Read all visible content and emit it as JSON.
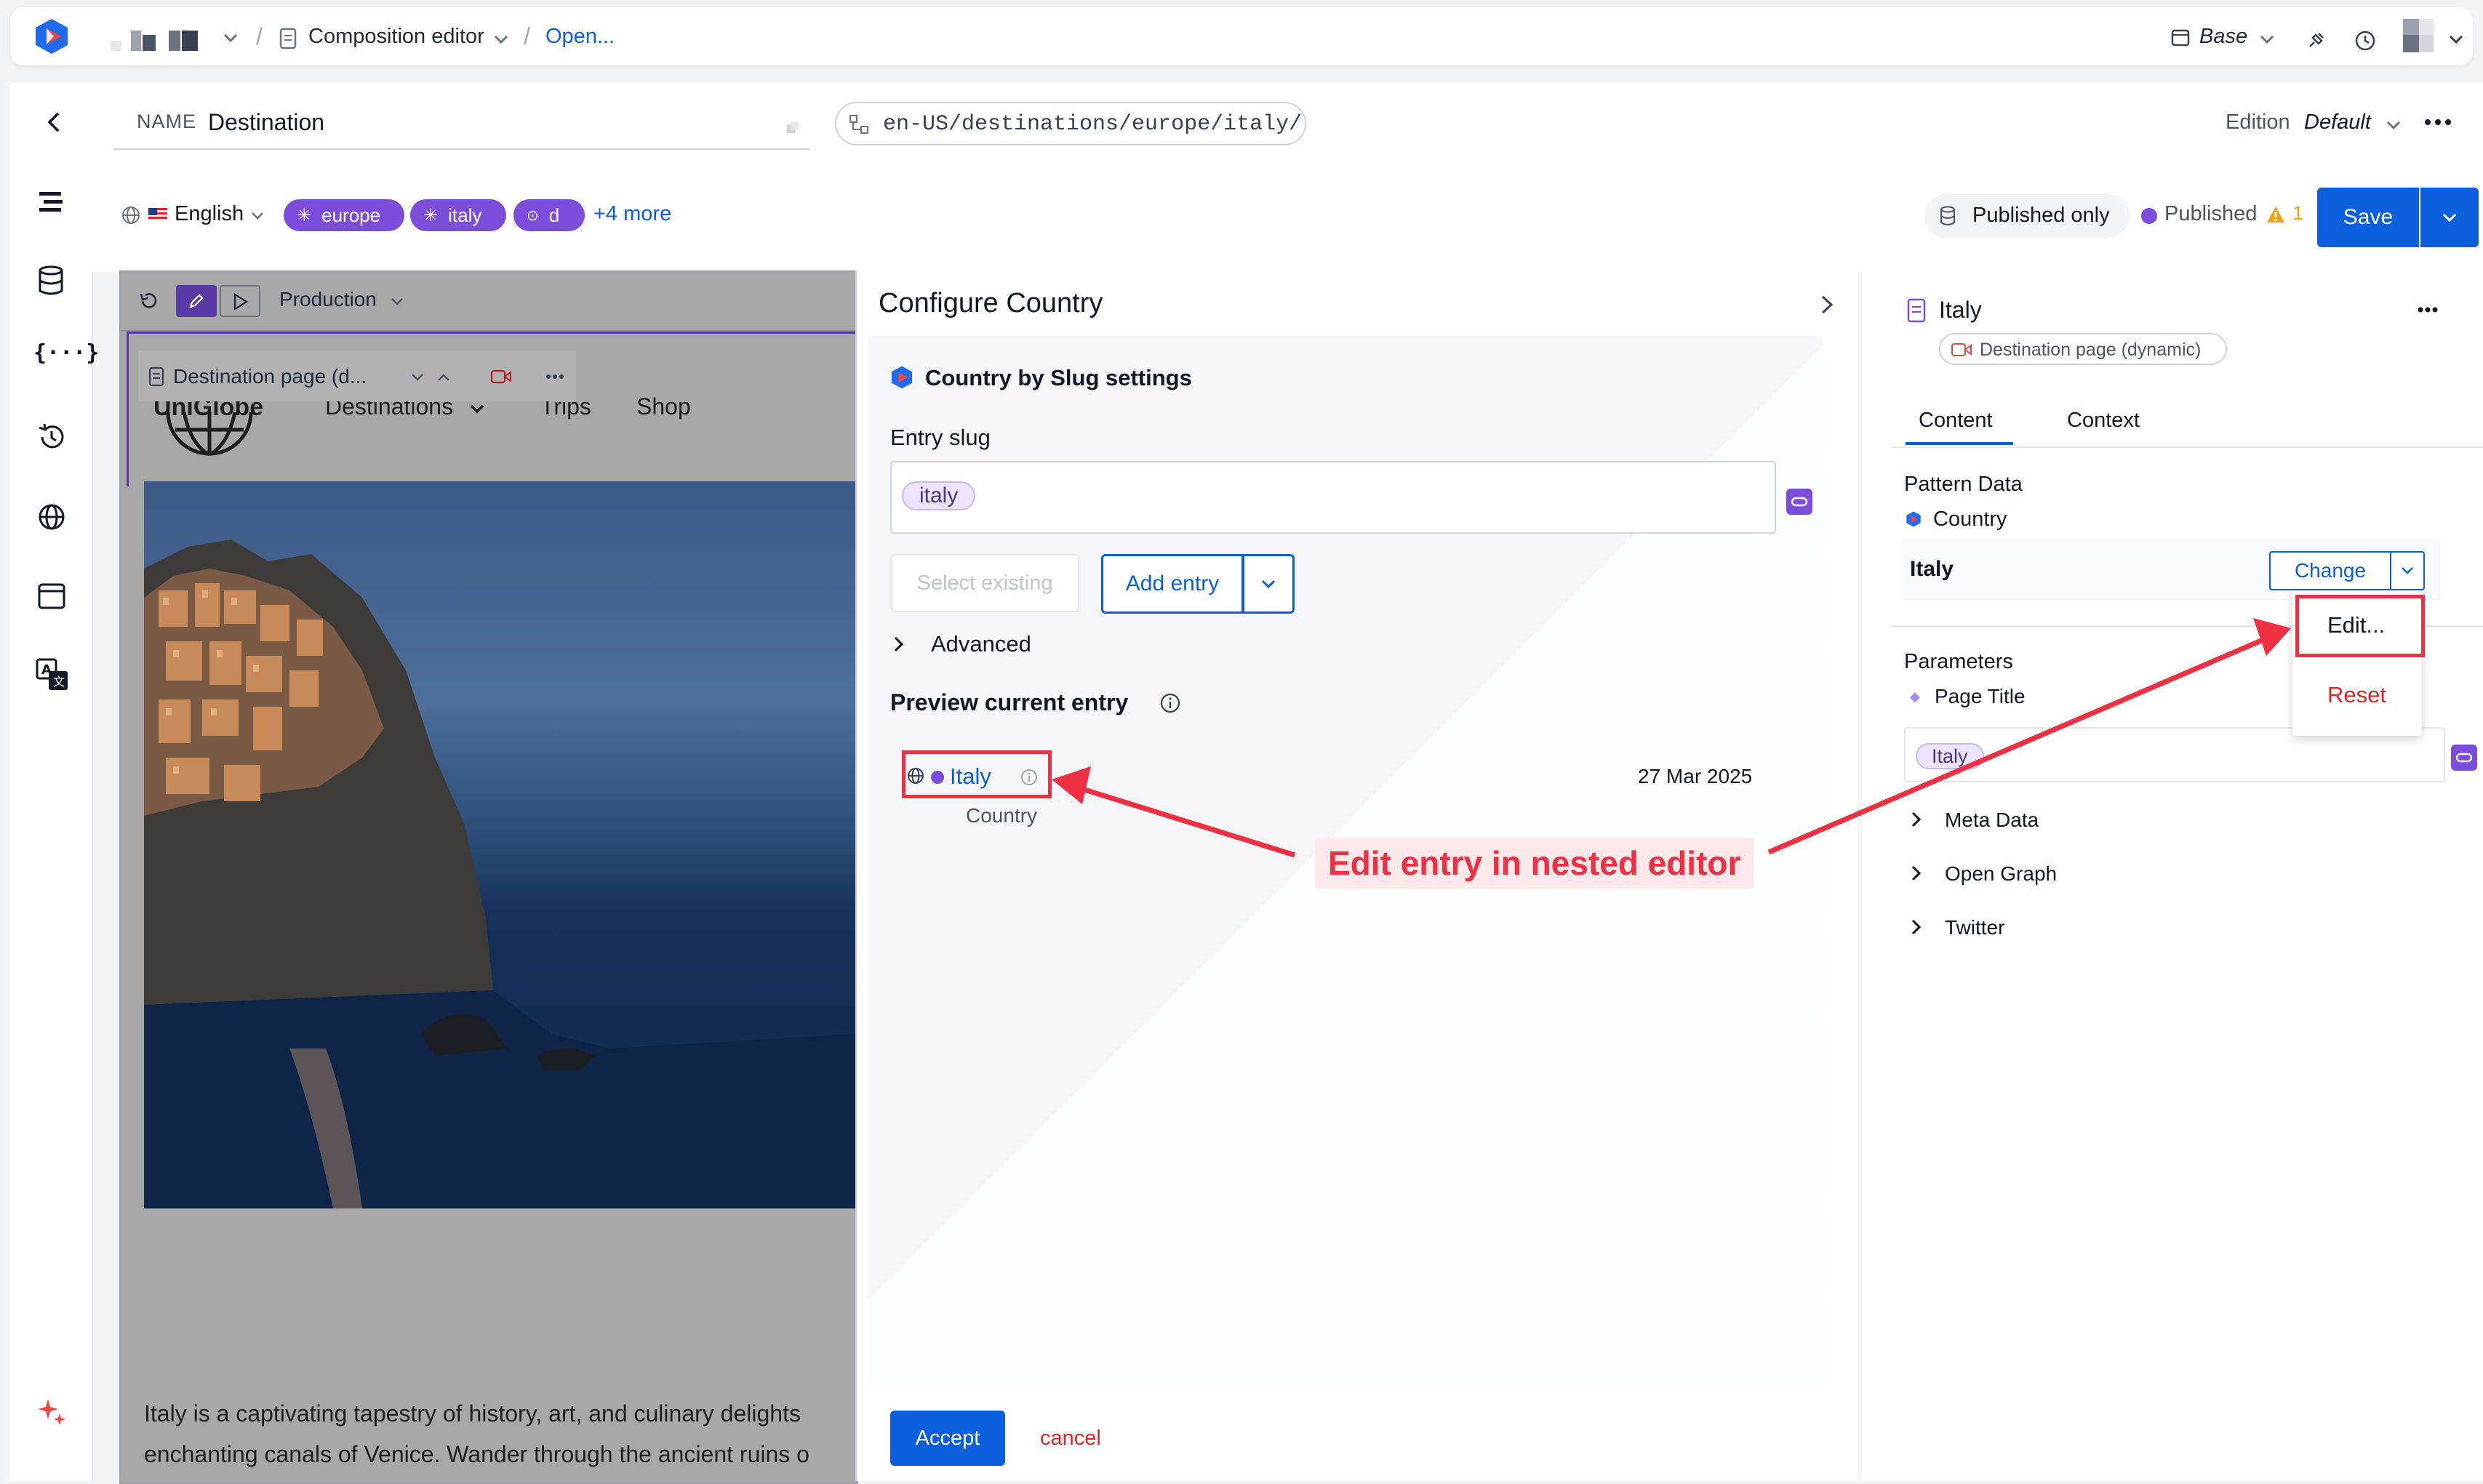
{
  "topbar": {
    "breadcrumb_editor": "Composition editor",
    "breadcrumb_open": "Open...",
    "base_label": "Base"
  },
  "toolbar": {
    "name_label": "NAME",
    "name_value": "Destination",
    "url_path": "en-US/destinations/europe/italy/",
    "edition_label": "Edition",
    "edition_value": "Default"
  },
  "subbar": {
    "language": "English",
    "chips": [
      "europe",
      "italy",
      "d"
    ],
    "more": "+4 more",
    "published_only": "Published only",
    "status": "Published",
    "warning_count": "1",
    "save": "Save"
  },
  "canvas": {
    "mode": "Production",
    "component_label": "Destination page (d...",
    "logo": "UniGlobe",
    "nav": [
      "Destinations",
      "Trips",
      "Shop"
    ],
    "body_line1": "Italy is a captivating tapestry of history, art, and culinary delights",
    "body_line2": "enchanting canals of Venice. Wander through the ancient ruins o"
  },
  "modal": {
    "title": "Configure Country",
    "section_title": "Country by Slug settings",
    "entry_slug_label": "Entry slug",
    "slug_value": "italy",
    "select_existing": "Select existing",
    "add_entry": "Add entry",
    "advanced": "Advanced",
    "preview_title": "Preview current entry",
    "entry_name": "Italy",
    "entry_type": "Country",
    "entry_date": "27 Mar 2025",
    "accept": "Accept",
    "cancel": "cancel"
  },
  "annotation": {
    "text": "Edit entry in nested editor"
  },
  "right": {
    "title": "Italy",
    "pattern_badge": "Destination page (dynamic)",
    "tabs": [
      "Content",
      "Context"
    ],
    "pattern_data_label": "Pattern Data",
    "country_label": "Country",
    "country_value": "Italy",
    "change": "Change",
    "menu_edit": "Edit...",
    "menu_reset": "Reset",
    "parameters_label": "Parameters",
    "page_title_label": "Page Title",
    "page_title_value": "Italy",
    "sections": [
      "Meta Data",
      "Open Graph",
      "Twitter"
    ]
  },
  "colors": {
    "accent": "#0b5fdc",
    "chip": "#7c4ddb",
    "annotation_red": "#ef2f42"
  }
}
